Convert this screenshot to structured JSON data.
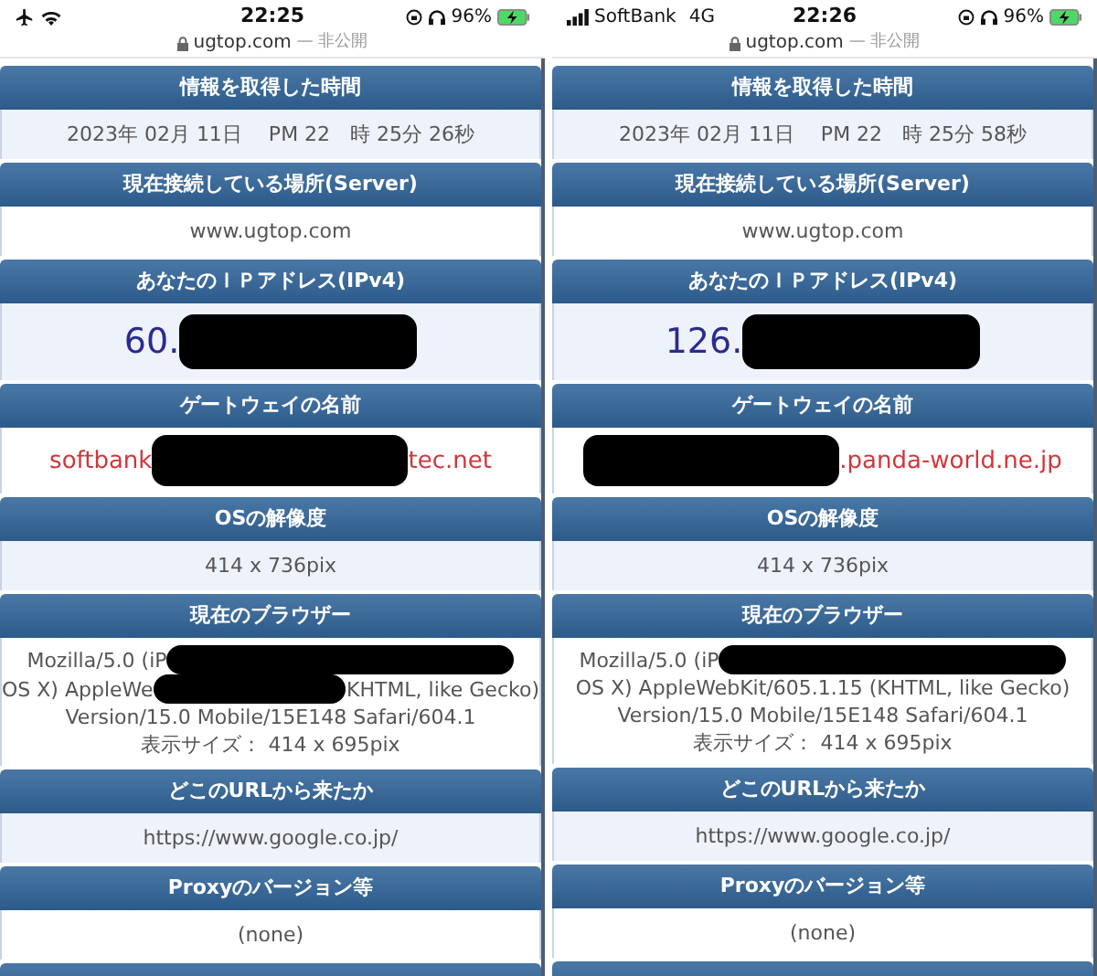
{
  "screens": [
    {
      "status_bar": {
        "left": [
          {
            "kind": "airplane"
          },
          {
            "kind": "wifi"
          }
        ],
        "time": "22:25",
        "battery": "96%"
      },
      "address": {
        "domain": "ugtop.com",
        "note": "— 非公開"
      },
      "sections": [
        {
          "title": "情報を取得した時間",
          "kind": "plain",
          "lines": [
            [
              {
                "kind": "text",
                "text": "2023年 02月 11日　 PM 22　時 25分 26秒"
              }
            ]
          ]
        },
        {
          "title": "現在接続している場所(Server)",
          "kind": "plain",
          "lines": [
            [
              {
                "kind": "text",
                "text": "www.ugtop.com"
              }
            ]
          ]
        },
        {
          "title": "あなたのＩＰアドレス(IPv4)",
          "kind": "ip",
          "lines": [
            [
              {
                "kind": "text",
                "text": "60."
              },
              {
                "kind": "redaction"
              }
            ]
          ]
        },
        {
          "title": "ゲートウェイの名前",
          "kind": "gateway",
          "lines": [
            [
              {
                "kind": "text",
                "text": "softbank"
              },
              {
                "kind": "redaction"
              },
              {
                "kind": "text",
                "text": "tec.net"
              }
            ]
          ]
        },
        {
          "title": "OSの解像度",
          "kind": "plain",
          "lines": [
            [
              {
                "kind": "text",
                "text": "414 x 736pix"
              }
            ]
          ]
        },
        {
          "title": "現在のブラウザー",
          "kind": "plain",
          "lines": [
            [
              {
                "kind": "text",
                "text": "Mozilla/5.0 (iP"
              },
              {
                "kind": "redaction"
              }
            ],
            [
              {
                "kind": "text",
                "text": "OS X) AppleWe"
              },
              {
                "kind": "redaction"
              },
              {
                "kind": "text",
                "text": "KHTML, like Gecko)"
              }
            ],
            [
              {
                "kind": "text",
                "text": "Version/15.0 Mobile/15E148 Safari/604.1"
              }
            ],
            [
              {
                "kind": "text",
                "text": "表示サイズ： 414 x 695pix"
              }
            ]
          ]
        },
        {
          "title": "どこのURLから来たか",
          "kind": "plain",
          "lines": [
            [
              {
                "kind": "text",
                "text": "https://www.google.co.jp/"
              }
            ]
          ]
        },
        {
          "title": "Proxyのバージョン等",
          "kind": "plain",
          "lines": [
            [
              {
                "kind": "text",
                "text": "(none)"
              }
            ]
          ]
        }
      ]
    },
    {
      "status_bar": {
        "left": [
          {
            "kind": "signal"
          },
          {
            "kind": "text",
            "text": "SoftBank"
          },
          {
            "kind": "text",
            "text": "4G"
          }
        ],
        "time": "22:26",
        "battery": "96%"
      },
      "address": {
        "domain": "ugtop.com",
        "note": "— 非公開"
      },
      "sections": [
        {
          "title": "情報を取得した時間",
          "kind": "plain",
          "lines": [
            [
              {
                "kind": "text",
                "text": "2023年 02月 11日　 PM 22　時 25分 58秒"
              }
            ]
          ]
        },
        {
          "title": "現在接続している場所(Server)",
          "kind": "plain",
          "lines": [
            [
              {
                "kind": "text",
                "text": "www.ugtop.com"
              }
            ]
          ]
        },
        {
          "title": "あなたのＩＰアドレス(IPv4)",
          "kind": "ip",
          "lines": [
            [
              {
                "kind": "text",
                "text": "126."
              },
              {
                "kind": "redaction"
              }
            ]
          ]
        },
        {
          "title": "ゲートウェイの名前",
          "kind": "gateway",
          "lines": [
            [
              {
                "kind": "redaction"
              },
              {
                "kind": "text",
                "text": ".panda-world.ne.jp"
              }
            ]
          ]
        },
        {
          "title": "OSの解像度",
          "kind": "plain",
          "lines": [
            [
              {
                "kind": "text",
                "text": "414 x 736pix"
              }
            ]
          ]
        },
        {
          "title": "現在のブラウザー",
          "kind": "plain",
          "lines": [
            [
              {
                "kind": "text",
                "text": "Mozilla/5.0 (iP"
              },
              {
                "kind": "redaction"
              }
            ],
            [
              {
                "kind": "text",
                "text": "OS X) AppleWebKit/605.1.15 (KHTML, like Gecko)"
              }
            ],
            [
              {
                "kind": "text",
                "text": "Version/15.0 Mobile/15E148 Safari/604.1"
              }
            ],
            [
              {
                "kind": "text",
                "text": "表示サイズ： 414 x 695pix"
              }
            ]
          ]
        },
        {
          "title": "どこのURLから来たか",
          "kind": "plain",
          "lines": [
            [
              {
                "kind": "text",
                "text": "https://www.google.co.jp/"
              }
            ]
          ]
        },
        {
          "title": "Proxyのバージョン等",
          "kind": "plain",
          "lines": [
            [
              {
                "kind": "text",
                "text": "(none)"
              }
            ]
          ]
        }
      ]
    }
  ]
}
